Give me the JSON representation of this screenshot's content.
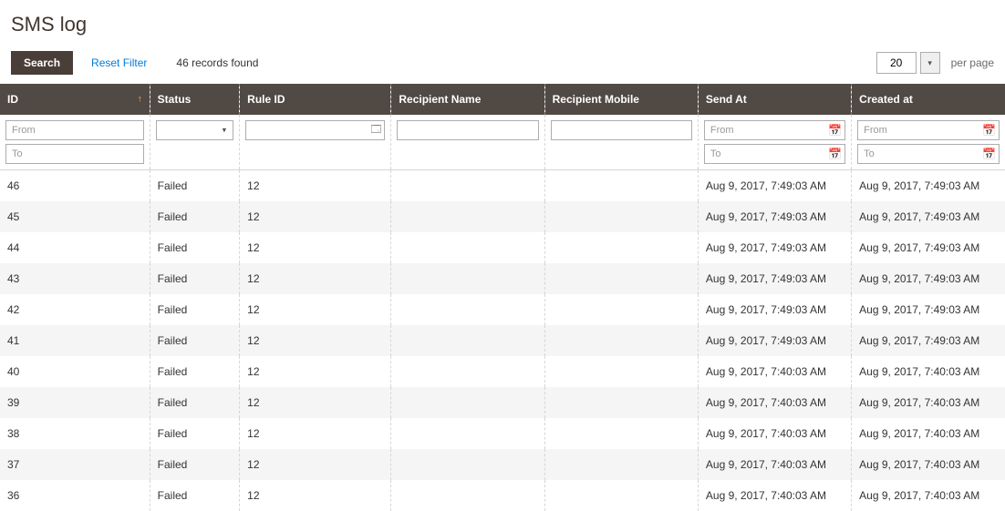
{
  "page": {
    "title": "SMS log"
  },
  "toolbar": {
    "search_label": "Search",
    "reset_label": "Reset Filter",
    "records_found": "46 records found"
  },
  "pager": {
    "page_size": "20",
    "caret": "▾",
    "per_page_label": "per page"
  },
  "columns": {
    "id": "ID",
    "status": "Status",
    "rule_id": "Rule ID",
    "recipient_name": "Recipient Name",
    "recipient_mobile": "Recipient Mobile",
    "send_at": "Send At",
    "created_at": "Created at"
  },
  "sort": {
    "id_indicator": "↑"
  },
  "filters": {
    "id_from_placeholder": "From",
    "id_to_placeholder": "To",
    "status_value": "",
    "rule_id_value": "",
    "recipient_name_value": "",
    "recipient_mobile_value": "",
    "send_from_placeholder": "From",
    "send_to_placeholder": "To",
    "created_from_placeholder": "From",
    "created_to_placeholder": "To"
  },
  "icons": {
    "calendar": "📅",
    "lookup": "🗔",
    "select_caret": "▾"
  },
  "rows": [
    {
      "id": "46",
      "status": "Failed",
      "rule_id": "12",
      "recipient_name": "",
      "recipient_mobile": "",
      "send_at": "Aug 9, 2017, 7:49:03 AM",
      "created_at": "Aug 9, 2017, 7:49:03 AM"
    },
    {
      "id": "45",
      "status": "Failed",
      "rule_id": "12",
      "recipient_name": "",
      "recipient_mobile": "",
      "send_at": "Aug 9, 2017, 7:49:03 AM",
      "created_at": "Aug 9, 2017, 7:49:03 AM"
    },
    {
      "id": "44",
      "status": "Failed",
      "rule_id": "12",
      "recipient_name": "",
      "recipient_mobile": "",
      "send_at": "Aug 9, 2017, 7:49:03 AM",
      "created_at": "Aug 9, 2017, 7:49:03 AM"
    },
    {
      "id": "43",
      "status": "Failed",
      "rule_id": "12",
      "recipient_name": "",
      "recipient_mobile": "",
      "send_at": "Aug 9, 2017, 7:49:03 AM",
      "created_at": "Aug 9, 2017, 7:49:03 AM"
    },
    {
      "id": "42",
      "status": "Failed",
      "rule_id": "12",
      "recipient_name": "",
      "recipient_mobile": "",
      "send_at": "Aug 9, 2017, 7:49:03 AM",
      "created_at": "Aug 9, 2017, 7:49:03 AM"
    },
    {
      "id": "41",
      "status": "Failed",
      "rule_id": "12",
      "recipient_name": "",
      "recipient_mobile": "",
      "send_at": "Aug 9, 2017, 7:49:03 AM",
      "created_at": "Aug 9, 2017, 7:49:03 AM"
    },
    {
      "id": "40",
      "status": "Failed",
      "rule_id": "12",
      "recipient_name": "",
      "recipient_mobile": "",
      "send_at": "Aug 9, 2017, 7:40:03 AM",
      "created_at": "Aug 9, 2017, 7:40:03 AM"
    },
    {
      "id": "39",
      "status": "Failed",
      "rule_id": "12",
      "recipient_name": "",
      "recipient_mobile": "",
      "send_at": "Aug 9, 2017, 7:40:03 AM",
      "created_at": "Aug 9, 2017, 7:40:03 AM"
    },
    {
      "id": "38",
      "status": "Failed",
      "rule_id": "12",
      "recipient_name": "",
      "recipient_mobile": "",
      "send_at": "Aug 9, 2017, 7:40:03 AM",
      "created_at": "Aug 9, 2017, 7:40:03 AM"
    },
    {
      "id": "37",
      "status": "Failed",
      "rule_id": "12",
      "recipient_name": "",
      "recipient_mobile": "",
      "send_at": "Aug 9, 2017, 7:40:03 AM",
      "created_at": "Aug 9, 2017, 7:40:03 AM"
    },
    {
      "id": "36",
      "status": "Failed",
      "rule_id": "12",
      "recipient_name": "",
      "recipient_mobile": "",
      "send_at": "Aug 9, 2017, 7:40:03 AM",
      "created_at": "Aug 9, 2017, 7:40:03 AM"
    }
  ]
}
